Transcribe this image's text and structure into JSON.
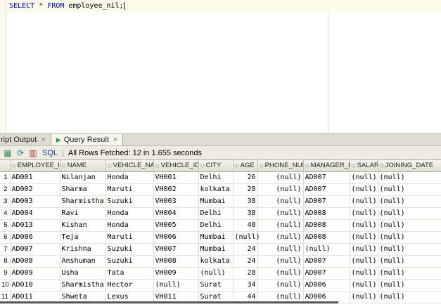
{
  "editor": {
    "query_select": "SELECT ",
    "query_star": "* ",
    "query_from": "FROM ",
    "query_rest": "employee_nil;"
  },
  "colors": {
    "keyword": "#0000c0",
    "operator": "#a00000",
    "play_icon": "#2f9e2f"
  },
  "tabs": [
    {
      "label": "ript Output",
      "close": "×",
      "active": false,
      "has_play_icon": false
    },
    {
      "label": "Query Result",
      "close": "×",
      "active": true,
      "has_play_icon": true
    }
  ],
  "toolbar": {
    "icons": [
      {
        "name": "grid-pin-icon",
        "glyph": "▦"
      },
      {
        "name": "refresh-icon",
        "glyph": "⟳"
      },
      {
        "name": "script-grid-icon",
        "glyph": "▥"
      }
    ],
    "sql_label": "SQL",
    "separator": "|",
    "status": "All Rows Fetched: 12 in 1.655 seconds"
  },
  "grid": {
    "columns": [
      "EMPLOYEE_ID",
      "NAME",
      "VEHICLE_NAME",
      "VEHICLE_ID",
      "CITY",
      "AGE",
      "PHONE_NUM",
      "MANAGER_ID",
      "SALARY",
      "JOINING_DATE"
    ],
    "rows": [
      [
        "AD001",
        "Nilanjan",
        "Honda",
        "VH001",
        "Delhi",
        "26",
        "(null)",
        "AD007",
        "(null)",
        "(null)"
      ],
      [
        "AD002",
        "Sharma",
        "Maruti",
        "VH002",
        "kolkata",
        "28",
        "(null)",
        "AD007",
        "(null)",
        "(null)"
      ],
      [
        "AD003",
        "Sharmistha",
        "Suzuki",
        "VH003",
        "Mumbai",
        "38",
        "(null)",
        "AD007",
        "(null)",
        "(null)"
      ],
      [
        "AD004",
        "Ravi",
        "Honda",
        "VH004",
        "Delhi",
        "38",
        "(null)",
        "AD008",
        "(null)",
        "(null)"
      ],
      [
        "AD013",
        "Kishan",
        "Honda",
        "VH005",
        "Delhi",
        "48",
        "(null)",
        "AD008",
        "(null)",
        "(null)"
      ],
      [
        "AD006",
        "Teja",
        "Maruti",
        "VH006",
        "Mumbai",
        "(null)",
        "(null)",
        "AD008",
        "(null)",
        "(null)"
      ],
      [
        "AD007",
        "Krishna",
        "Suzuki",
        "VH007",
        "Mumbai",
        "24",
        "(null)",
        "(null)",
        "(null)",
        "(null)"
      ],
      [
        "AD008",
        "Anshuman",
        "Suzuki",
        "VH008",
        "kolkata",
        "24",
        "(null)",
        "AD007",
        "(null)",
        "(null)"
      ],
      [
        "AD009",
        "Usha",
        "Tata",
        "VH009",
        "(null)",
        "28",
        "(null)",
        "AD007",
        "(null)",
        "(null)"
      ],
      [
        "AD010",
        "Sharmistha",
        "Hector",
        "(null)",
        "Surat",
        "34",
        "(null)",
        "AD006",
        "(null)",
        "(null)"
      ],
      [
        "AD011",
        "Shweta",
        "Lexus",
        "VH011",
        "Surat",
        "44",
        "(null)",
        "AD006",
        "(null)",
        "(null)"
      ]
    ]
  }
}
